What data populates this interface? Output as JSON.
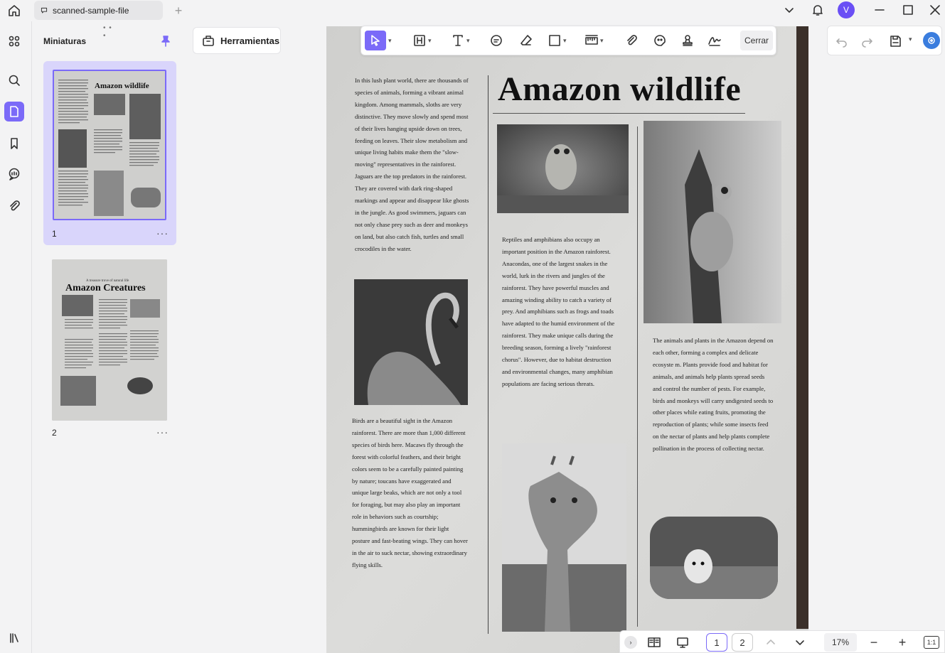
{
  "window": {
    "tab_title": "scanned-sample-file",
    "new_tab": "+",
    "avatar_initial": "V"
  },
  "sidebar": {
    "title": "Miniaturas",
    "pages": [
      {
        "number": "1",
        "more": "···"
      },
      {
        "number": "2",
        "more": "···"
      }
    ],
    "thumb2_subtitle": "A treasure trove of natural life",
    "thumb2_title": "Amazon Creatures",
    "thumb1_title": "Amazon wildlife"
  },
  "toolbar": {
    "tools_label": "Herramientas",
    "close_label": "Cerrar"
  },
  "document": {
    "title": "Amazon wildlife",
    "col1_para1": "In this lush plant world, there are thousands of species of animals, forming a vibrant animal kingdom. Among mammals, sloths are very distinctive. They move slowly and spend most of their lives hanging upside down on trees, feeding on leaves. Their slow metabolism and unique living habits make them the \"slow-moving\" representatives in the rainforest. Jaguars are the top predators in the rainforest. They are covered with dark ring-shaped markings and appear and disappear like ghosts in the jungle. As good swimmers, jaguars can not only chase prey such as deer and monkeys on land, but also catch fish, turtles and small crocodiles in the water.",
    "col1_para2": "Birds are a beautiful sight in the Amazon rainforest. There are more than 1,000 different species of birds here. Macaws fly through the forest with colorful feathers, and their bright colors seem to be a carefully painted painting by nature; toucans have exaggerated and unique large beaks, which are not only a tool for foraging, but may also play an important role in behaviors such as courtship; hummingbirds are known for their light posture and fast-beating wings. They can hover in the air to suck nectar, showing extraordinary flying skills.",
    "col2_para": "Reptiles and amphibians also occupy an important position in the Amazon rainforest. Anacondas, one of the largest snakes in the world, lurk in the rivers and jungles of the rainforest. They have powerful muscles and amazing winding ability to catch a variety of prey. And amphibians such as frogs and toads have adapted to the humid environment of the rainforest. They make unique calls during the breeding season, forming a lively \"rainforest chorus\". However, due to habitat destruction and environmental changes, many amphibian populations are facing serious threats.",
    "col3_para": "The animals and plants in the Amazon depend on each other, forming a complex and delicate ecosyste m. Plants provide food and habitat for animals, and animals help plants spread seeds and control the number of pests. For example, birds and monkeys will carry undigested seeds to other places while eating fruits, promoting the reproduction of plants; while some insects feed on the nectar of plants and help plants complete pollination in the process of collecting nectar."
  },
  "statusbar": {
    "page1": "1",
    "page2": "2",
    "zoom": "17%",
    "fit": "1:1",
    "minus": "−",
    "plus": "+"
  },
  "colors": {
    "accent": "#7b6af8",
    "thumb_selected_bg": "#d9d5fb"
  }
}
